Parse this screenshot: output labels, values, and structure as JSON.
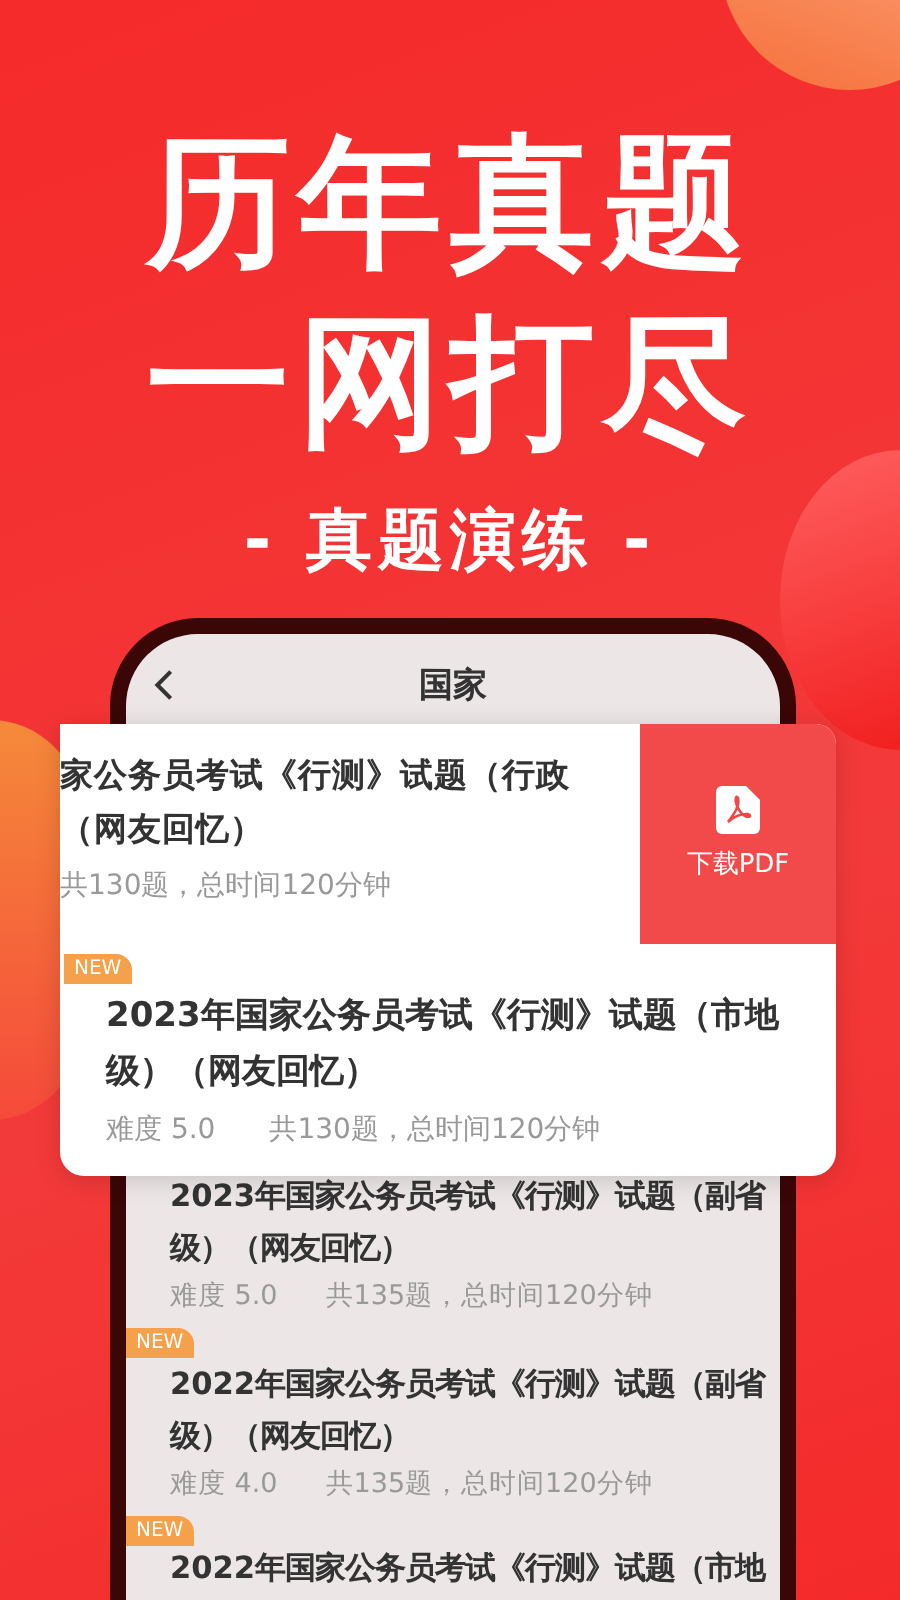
{
  "headline": {
    "lines": [
      "历年真题",
      "一网打尽"
    ],
    "subtitle": "- 真题演练 -"
  },
  "phone": {
    "nav_title": "国家",
    "list": [
      {
        "title": "2023年国家公务员考试《行测》试题（副省级）（网友回忆）",
        "difficulty": "难度 5.0",
        "meta": "共135题，总时间120分钟"
      },
      {
        "badge": "NEW",
        "title": "2022年国家公务员考试《行测》试题（副省级）（网友回忆）",
        "difficulty": "难度 4.0",
        "meta": "共135题，总时间120分钟"
      },
      {
        "badge": "NEW",
        "title": "2022年国家公务员考试《行测》试题（市地"
      }
    ]
  },
  "cards": [
    {
      "kind": "swiped",
      "title_lines": [
        "家公务员考试《行测》试题（行政",
        "（网友回忆）"
      ],
      "meta": "共130题，总时间120分钟",
      "action": "下载PDF"
    },
    {
      "kind": "item",
      "badge": "NEW",
      "title": "2023年国家公务员考试《行测》试题（市地级）（网友回忆）",
      "difficulty": "难度 5.0",
      "meta": "共130题，总时间120分钟"
    }
  ]
}
